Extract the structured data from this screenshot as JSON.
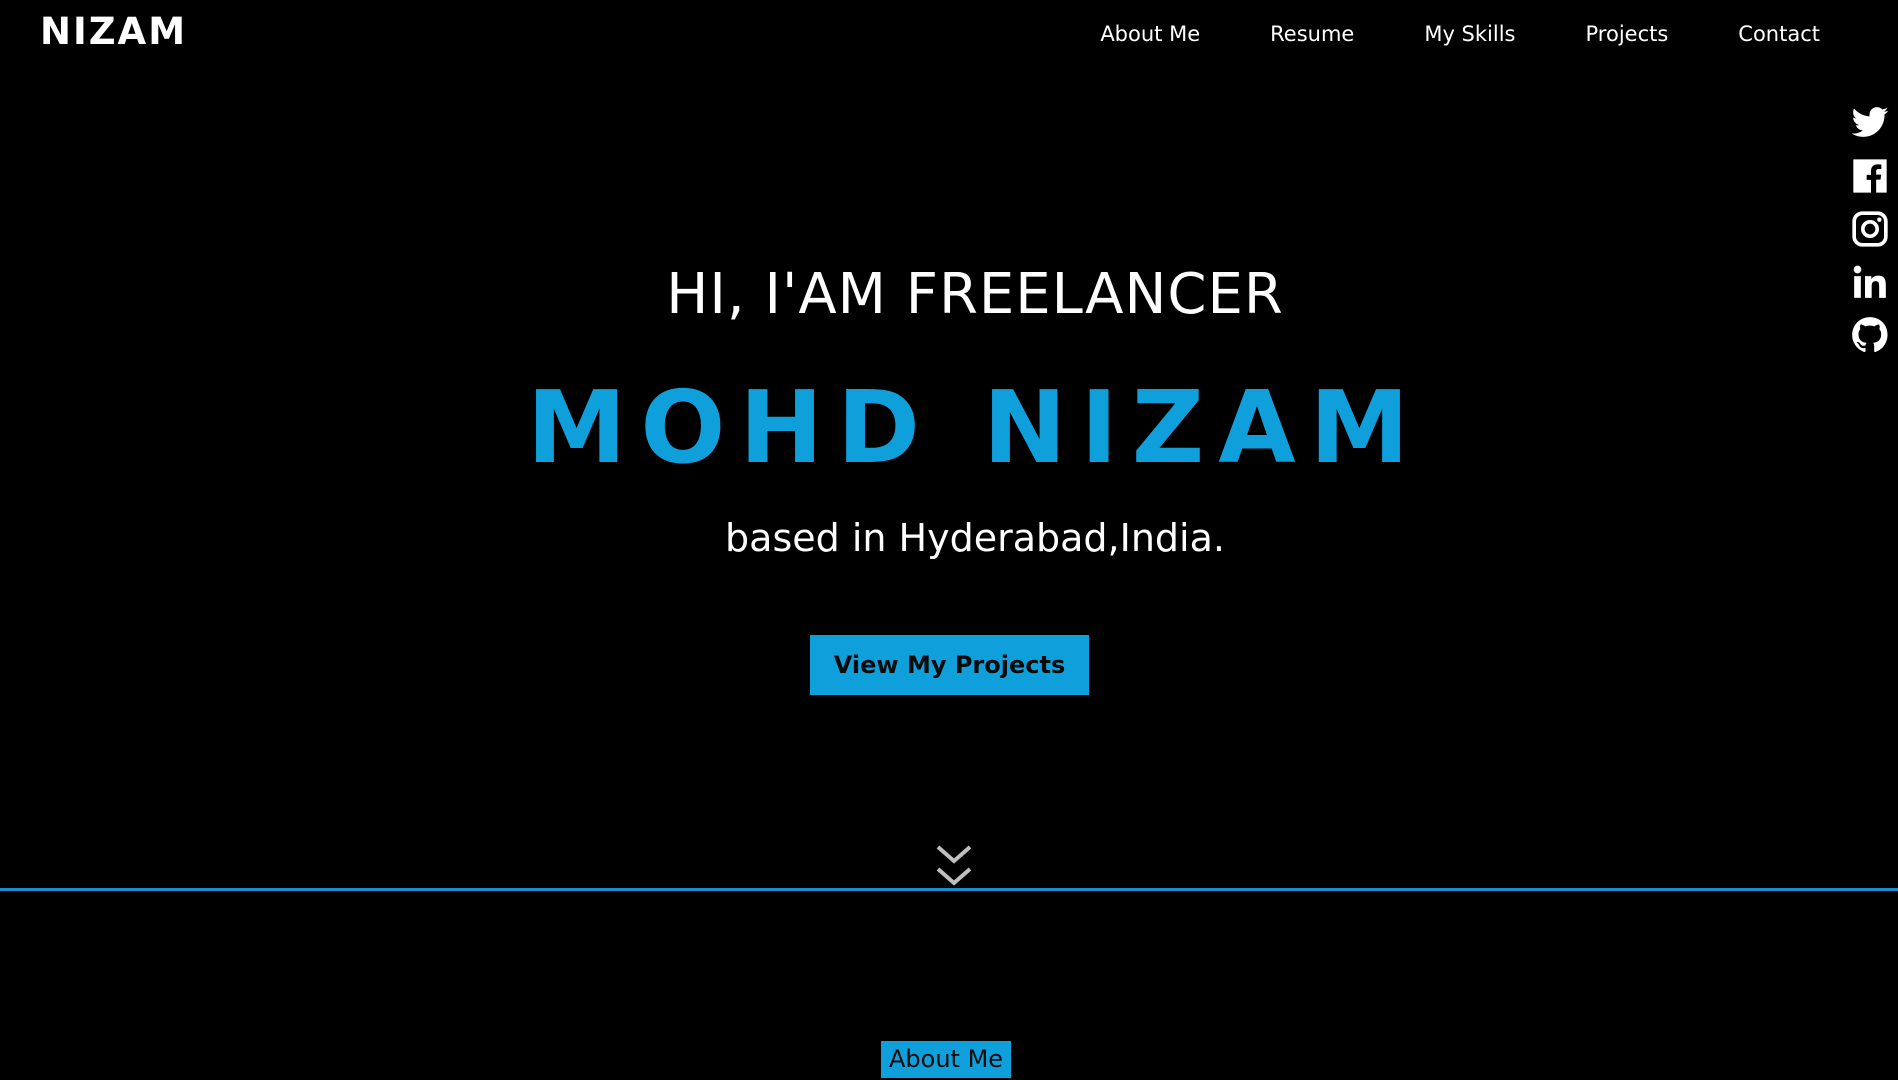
{
  "header": {
    "logo": "NIZAM",
    "nav": [
      {
        "label": "About Me"
      },
      {
        "label": "Resume"
      },
      {
        "label": "My Skills"
      },
      {
        "label": "Projects"
      },
      {
        "label": "Contact"
      }
    ]
  },
  "social": [
    {
      "icon": "twitter-icon"
    },
    {
      "icon": "facebook-icon"
    },
    {
      "icon": "instagram-icon"
    },
    {
      "icon": "linkedin-icon"
    },
    {
      "icon": "github-icon"
    }
  ],
  "hero": {
    "greeting": "HI, I'AM FREELANCER",
    "name": "MOHD NIZAM",
    "location": "based in Hyderabad,India.",
    "cta_label": "View My Projects",
    "scroll_icon": "double-chevron-down-icon"
  },
  "section": {
    "label": "About Me"
  },
  "colors": {
    "accent": "#0fa0dc",
    "background": "#000000",
    "text": "#ffffff",
    "divider": "#1a8fd0"
  }
}
